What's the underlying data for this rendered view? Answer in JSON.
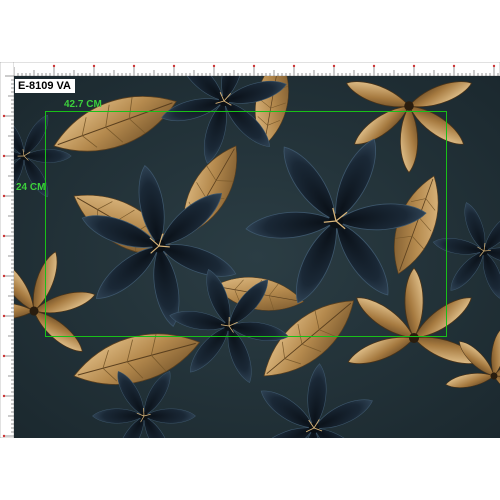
{
  "product_code": "E-8109 VA",
  "print_area": {
    "width_label": "42.7 CM",
    "height_label": "24 CM",
    "border_color": "#18c018"
  },
  "colors": {
    "background": "#223238",
    "dark_petal": "#111c25",
    "petal_highlight": "#3b536a",
    "gold": "#b58a4e",
    "gold_light": "#e3c08a"
  }
}
